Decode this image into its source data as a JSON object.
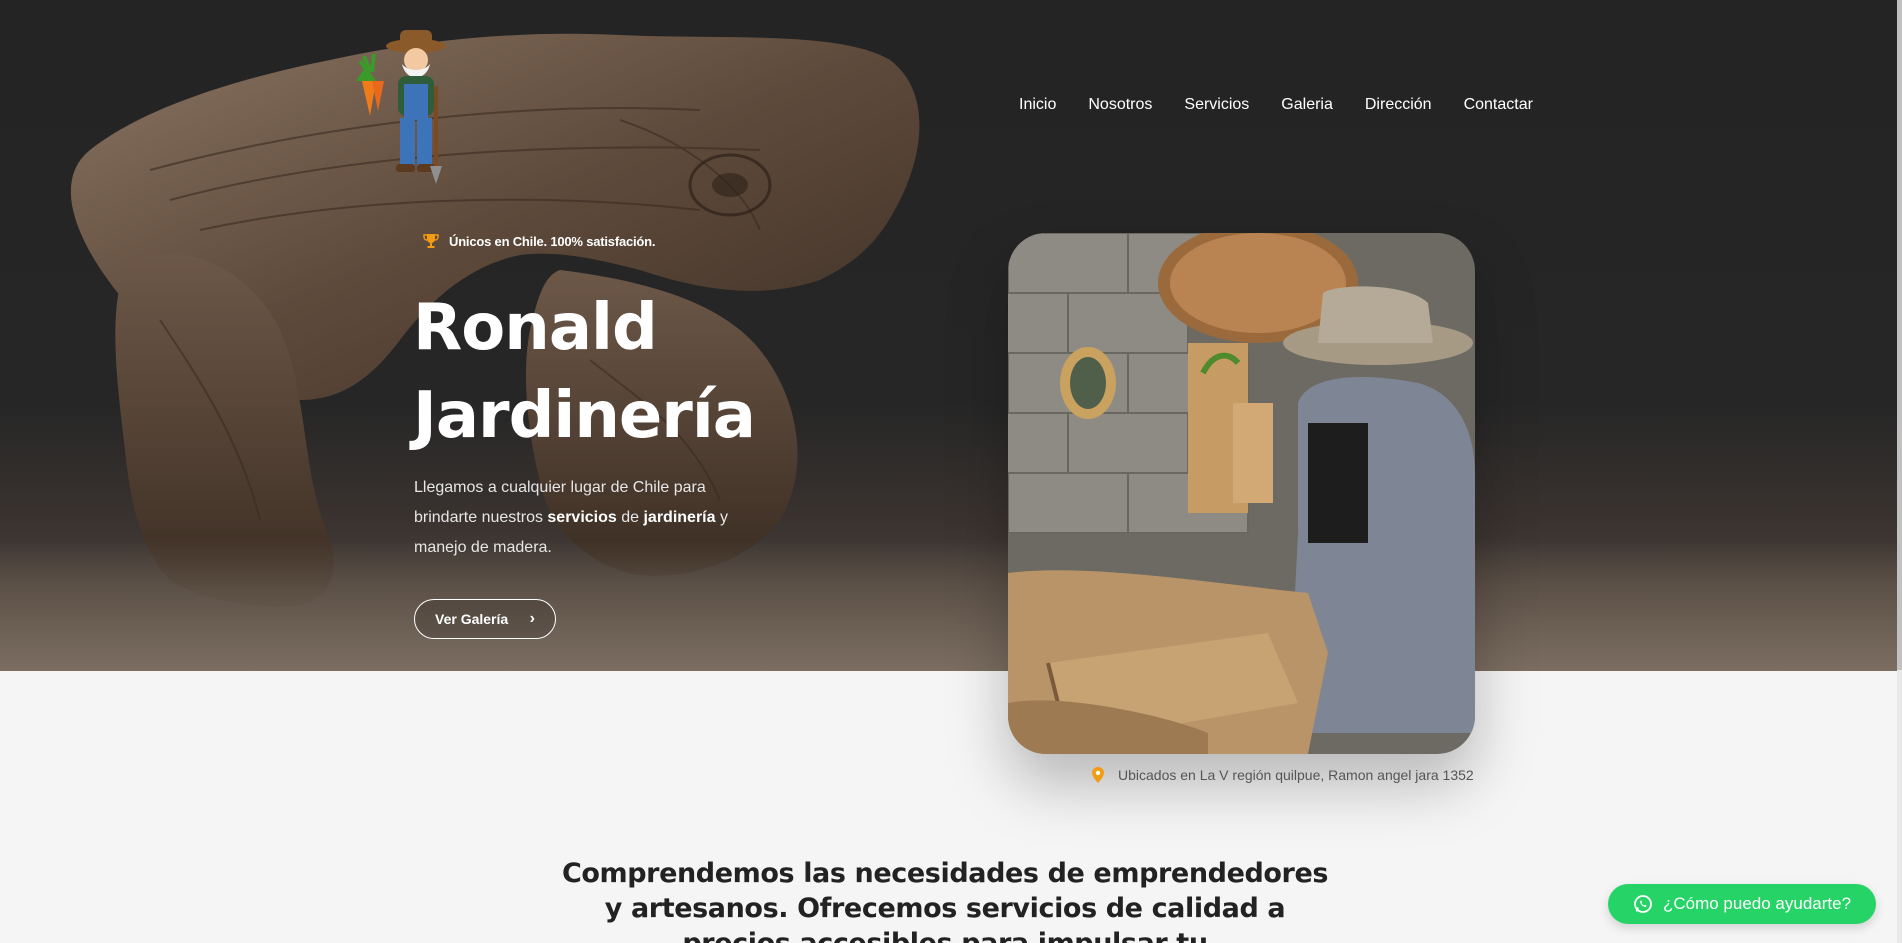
{
  "nav": {
    "items": [
      "Inicio",
      "Nosotros",
      "Servicios",
      "Galeria",
      "Dirección",
      "Contactar"
    ]
  },
  "hero": {
    "badge": "Únicos en Chile. 100% satisfación.",
    "title_line1": "Ronald",
    "title_line2": "Jardinería",
    "text_part1": "Llegamos a cualquier lugar de Chile para brindarte nuestros ",
    "text_bold1": "servicios",
    "text_part2": " de ",
    "text_bold2": "jardinería",
    "text_part3": " y manejo de madera.",
    "button_label": "Ver Galería"
  },
  "location": {
    "text": "Ubicados en La V región quilpue, Ramon angel jara 1352"
  },
  "about": {
    "heading": "Comprendemos las necesidades de emprendedores y artesanos. Ofrecemos servicios de calidad a precios accesibles para impulsar tu"
  },
  "whatsapp": {
    "label": "¿Cómo puedo ayudarte?"
  },
  "icons": {
    "badge": "trophy-icon",
    "button": "chevron-right-icon",
    "location": "map-pin-icon",
    "whatsapp": "whatsapp-icon"
  },
  "colors": {
    "hero_bg": "#242424",
    "accent_orange": "#f39c12",
    "whatsapp_green": "#25d366",
    "page_bg": "#f5f5f5"
  }
}
